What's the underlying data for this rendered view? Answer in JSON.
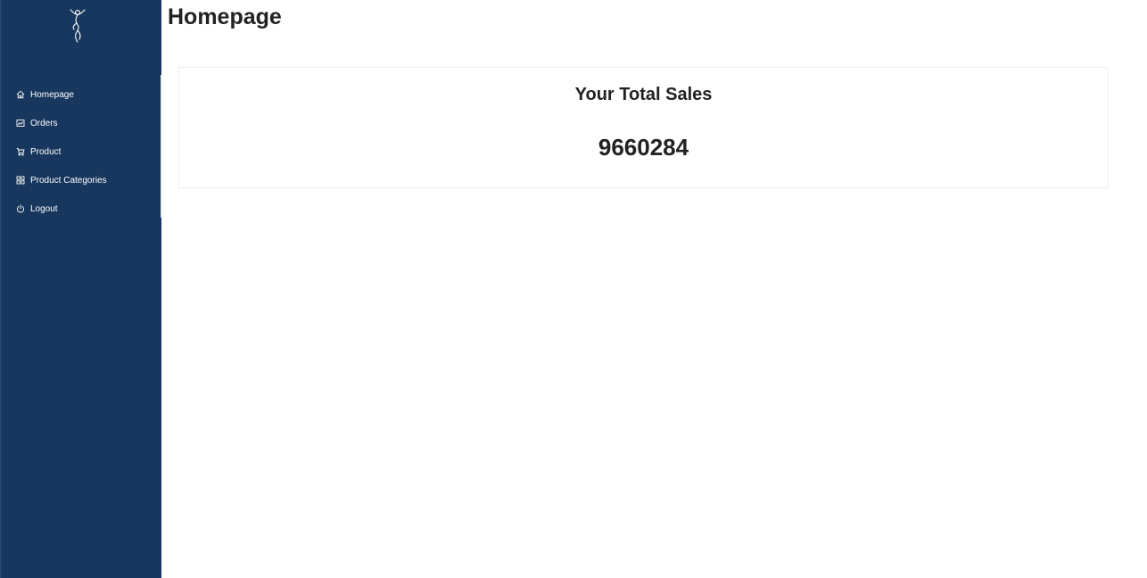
{
  "sidebar": {
    "logo_icon": "dancer-logo-icon",
    "items": [
      {
        "label": "Homepage",
        "icon": "home-icon"
      },
      {
        "label": "Orders",
        "icon": "chart-icon"
      },
      {
        "label": "Product",
        "icon": "cart-icon"
      },
      {
        "label": "Product Categories",
        "icon": "grid-icon"
      },
      {
        "label": "Logout",
        "icon": "power-icon"
      }
    ]
  },
  "main": {
    "title": "Homepage",
    "sales_card": {
      "title": "Your Total Sales",
      "value": "9660284"
    }
  },
  "colors": {
    "sidebar_bg": "#17375e",
    "text": "#222222"
  }
}
